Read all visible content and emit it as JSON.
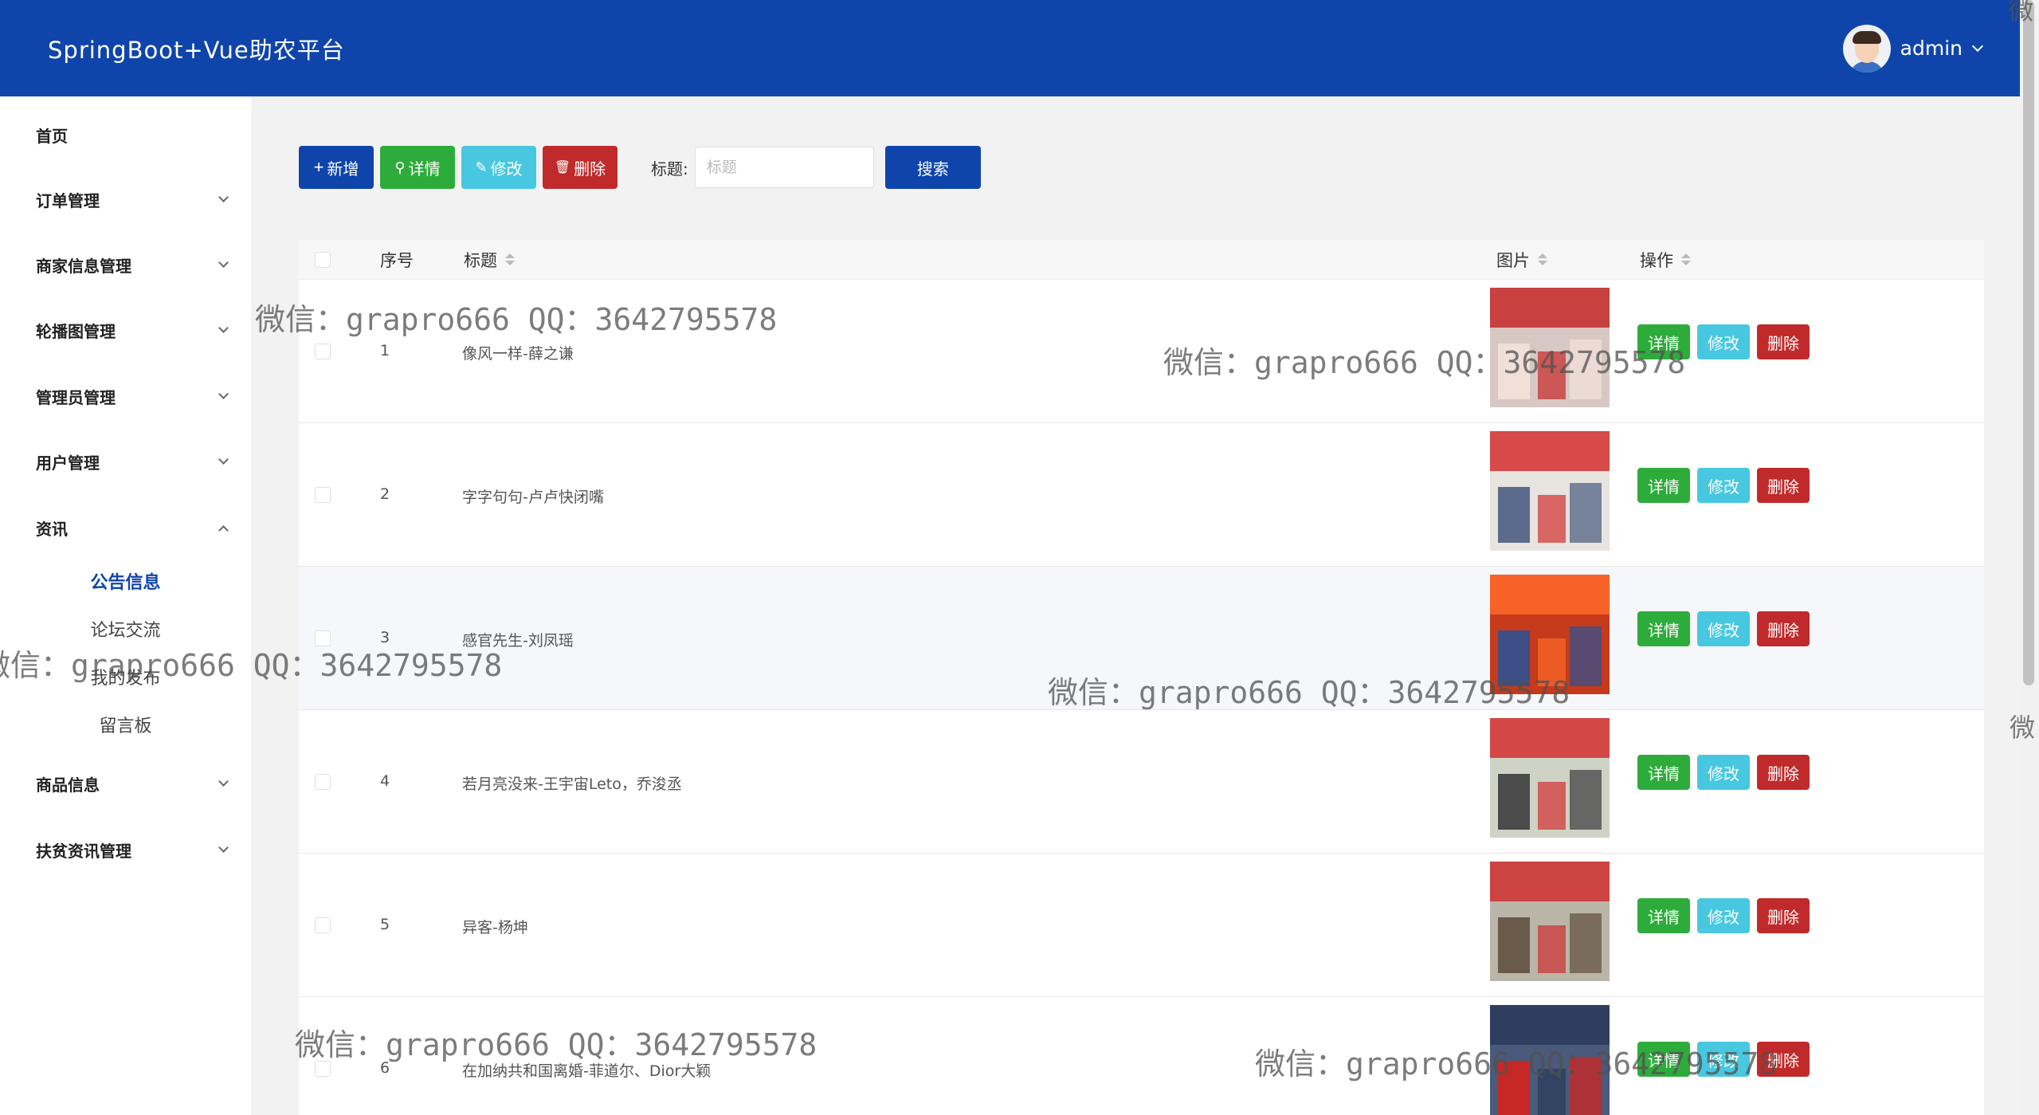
{
  "header": {
    "title": "SpringBoot+Vue助农平台",
    "username": "admin"
  },
  "sidebar": {
    "items": [
      {
        "label": "首页",
        "expandable": false
      },
      {
        "label": "订单管理",
        "expandable": true
      },
      {
        "label": "商家信息管理",
        "expandable": true
      },
      {
        "label": "轮播图管理",
        "expandable": true
      },
      {
        "label": "管理员管理",
        "expandable": true
      },
      {
        "label": "用户管理",
        "expandable": true
      },
      {
        "label": "资讯",
        "expandable": true,
        "expanded": true
      },
      {
        "label": "商品信息",
        "expandable": true
      },
      {
        "label": "扶贫资讯管理",
        "expandable": true
      }
    ],
    "submenu": [
      {
        "label": "公告信息",
        "active": true
      },
      {
        "label": "论坛交流"
      },
      {
        "label": "我的发布"
      },
      {
        "label": "留言板"
      }
    ]
  },
  "toolbar": {
    "add_label": "新增",
    "detail_label": "详情",
    "edit_label": "修改",
    "delete_label": "删除",
    "search_label": "标题:",
    "search_placeholder": "标题",
    "search_button": "搜索"
  },
  "table": {
    "headers": {
      "index": "序号",
      "title": "标题",
      "image": "图片",
      "actions": "操作"
    },
    "action_labels": {
      "detail": "详情",
      "edit": "修改",
      "delete": "删除"
    },
    "rows": [
      {
        "index": "1",
        "title": "像风一样-薛之谦"
      },
      {
        "index": "2",
        "title": "字字句句-卢卢快闭嘴"
      },
      {
        "index": "3",
        "title": "感官先生-刘凤瑶"
      },
      {
        "index": "4",
        "title": "若月亮没来-王宇宙Leto，乔浚丞"
      },
      {
        "index": "5",
        "title": "异客-杨坤"
      },
      {
        "index": "6",
        "title": "在加纳共和国离婚-菲道尔、Dior大颖"
      }
    ]
  },
  "watermark": {
    "text": "微信：grapro666 QQ：3642795578",
    "edge_char": "微"
  },
  "colors": {
    "header": "#0f45aa",
    "primary": "#0f45aa",
    "success": "#2eac3b",
    "info": "#48c8e0",
    "danger": "#c12a2a"
  }
}
